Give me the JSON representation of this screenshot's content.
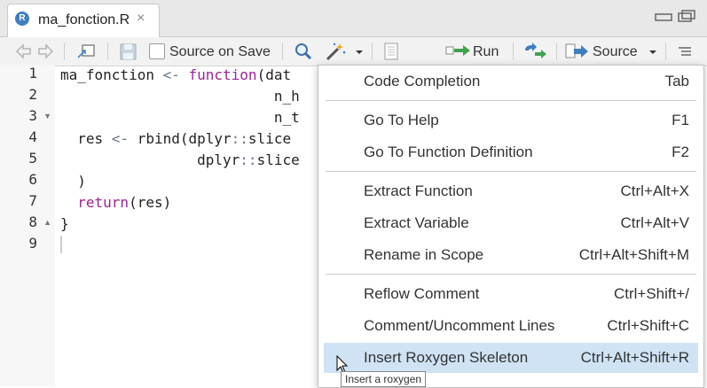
{
  "tab": {
    "filename": "ma_fonction.R",
    "close_glyph": "×",
    "logo_letter": "R"
  },
  "toolbar": {
    "source_on_save": "Source on Save",
    "run": "Run",
    "source": "Source"
  },
  "gutter": {
    "line_numbers": [
      "1",
      "2",
      "3",
      "4",
      "5",
      "6",
      "7",
      "8",
      "9"
    ]
  },
  "code": {
    "lines": [
      {
        "parts": [
          "ma_fonction ",
          "<-",
          " ",
          "function",
          "(dat"
        ]
      },
      {
        "text": "                         n_h"
      },
      {
        "text": "                         n_t"
      },
      {
        "parts": [
          "  res ",
          "<-",
          " rbind(dplyr",
          "::",
          "slice"
        ]
      },
      {
        "parts": [
          "                dplyr",
          "::",
          "slice"
        ]
      },
      {
        "text": "  )"
      },
      {
        "parts": [
          "  ",
          "return",
          "(res)"
        ]
      },
      {
        "text": "}"
      },
      {
        "text": ""
      }
    ]
  },
  "menu": {
    "items": [
      {
        "label": "Code Completion",
        "shortcut": "Tab"
      },
      {
        "label": "Go To Help",
        "shortcut": "F1"
      },
      {
        "label": "Go To Function Definition",
        "shortcut": "F2"
      },
      {
        "label": "Extract Function",
        "shortcut": "Ctrl+Alt+X"
      },
      {
        "label": "Extract Variable",
        "shortcut": "Ctrl+Alt+V"
      },
      {
        "label": "Rename in Scope",
        "shortcut": "Ctrl+Alt+Shift+M"
      },
      {
        "label": "Reflow Comment",
        "shortcut": "Ctrl+Shift+/"
      },
      {
        "label": "Comment/Uncomment Lines",
        "shortcut": "Ctrl+Shift+C"
      },
      {
        "label": "Insert Roxygen Skeleton",
        "shortcut": "Ctrl+Alt+Shift+R"
      }
    ],
    "highlighted_item": "Insert Roxygen Skeleton"
  },
  "tooltip": {
    "text": "Insert a roxygen"
  },
  "icons": {
    "back": "back-arrow-icon",
    "forward": "forward-arrow-icon",
    "show_in_window": "show-in-window-icon",
    "save": "save-icon",
    "search": "search-icon",
    "code_tools": "magic-wand-icon",
    "compile_report": "notebook-icon",
    "run": "run-arrow-icon",
    "rerun": "rerun-icon",
    "source": "source-icon",
    "outline": "outline-icon"
  },
  "colors": {
    "keyword": "#9b2393",
    "operator": "#687687",
    "highlight": "#cfe3f5",
    "accent": "#3f7fc0"
  }
}
